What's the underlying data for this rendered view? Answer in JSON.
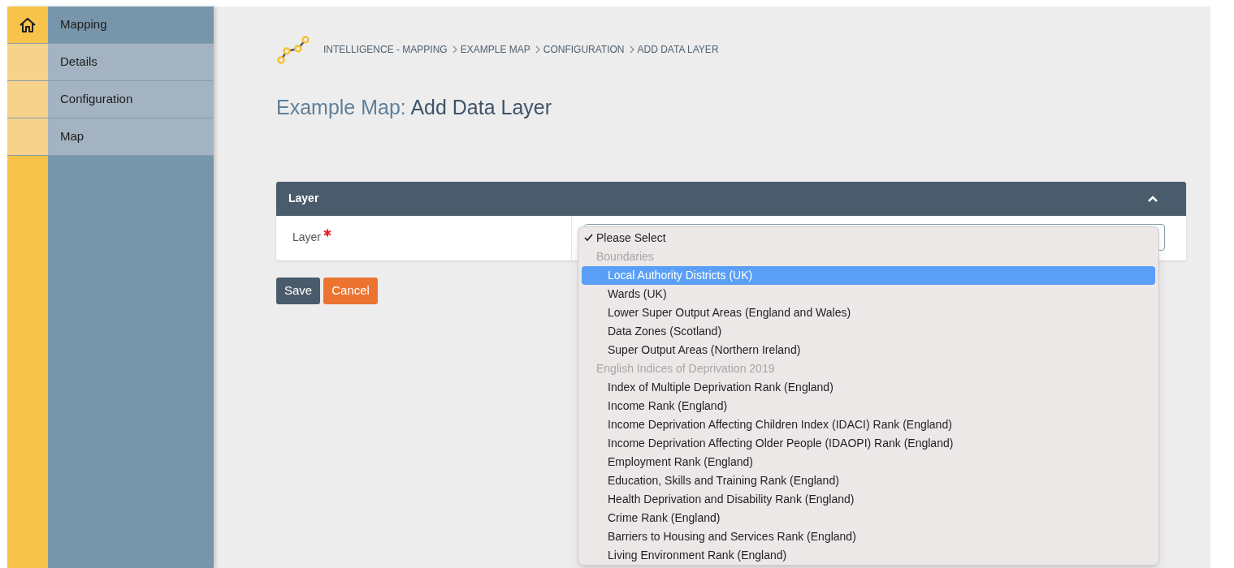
{
  "sidebar": {
    "items": [
      {
        "label": "Mapping",
        "selected": true
      },
      {
        "label": "Details",
        "selected": false
      },
      {
        "label": "Configuration",
        "selected": false
      },
      {
        "label": "Map",
        "selected": false
      }
    ]
  },
  "breadcrumb": [
    "INTELLIGENCE - MAPPING",
    "EXAMPLE MAP",
    "CONFIGURATION",
    "ADD DATA LAYER"
  ],
  "page_title": {
    "prefix": "Example Map:",
    "title": "Add Data Layer"
  },
  "panel": {
    "title": "Layer",
    "expanded": true,
    "field": {
      "label": "Layer",
      "required": true
    }
  },
  "buttons": [
    {
      "label": "Save",
      "kind": "primary"
    },
    {
      "label": "Cancel",
      "kind": "cancel"
    }
  ],
  "dropdown": {
    "items": [
      {
        "kind": "option",
        "label": "Please Select",
        "checked": true,
        "selected": false
      },
      {
        "kind": "group",
        "label": "Boundaries"
      },
      {
        "kind": "option",
        "label": "Local Authority Districts (UK)",
        "checked": false,
        "selected": true
      },
      {
        "kind": "option",
        "label": "Wards (UK)",
        "checked": false,
        "selected": false
      },
      {
        "kind": "option",
        "label": "Lower Super Output Areas (England and Wales)",
        "checked": false,
        "selected": false
      },
      {
        "kind": "option",
        "label": "Data Zones (Scotland)",
        "checked": false,
        "selected": false
      },
      {
        "kind": "option",
        "label": "Super Output Areas (Northern Ireland)",
        "checked": false,
        "selected": false
      },
      {
        "kind": "group",
        "label": "English Indices of Deprivation 2019"
      },
      {
        "kind": "option",
        "label": "Index of Multiple Deprivation Rank (England)",
        "checked": false,
        "selected": false
      },
      {
        "kind": "option",
        "label": "Income Rank (England)",
        "checked": false,
        "selected": false
      },
      {
        "kind": "option",
        "label": "Income Deprivation Affecting Children Index (IDACI) Rank (England)",
        "checked": false,
        "selected": false
      },
      {
        "kind": "option",
        "label": "Income Deprivation Affecting Older People (IDAOPI) Rank (England)",
        "checked": false,
        "selected": false
      },
      {
        "kind": "option",
        "label": "Employment Rank (England)",
        "checked": false,
        "selected": false
      },
      {
        "kind": "option",
        "label": "Education, Skills and Training Rank (England)",
        "checked": false,
        "selected": false
      },
      {
        "kind": "option",
        "label": "Health Deprivation and Disability Rank (England)",
        "checked": false,
        "selected": false
      },
      {
        "kind": "option",
        "label": "Crime Rank (England)",
        "checked": false,
        "selected": false
      },
      {
        "kind": "option",
        "label": "Barriers to Housing and Services Rank (England)",
        "checked": false,
        "selected": false
      },
      {
        "kind": "option",
        "label": "Living Environment Rank (England)",
        "checked": false,
        "selected": false
      }
    ]
  }
}
